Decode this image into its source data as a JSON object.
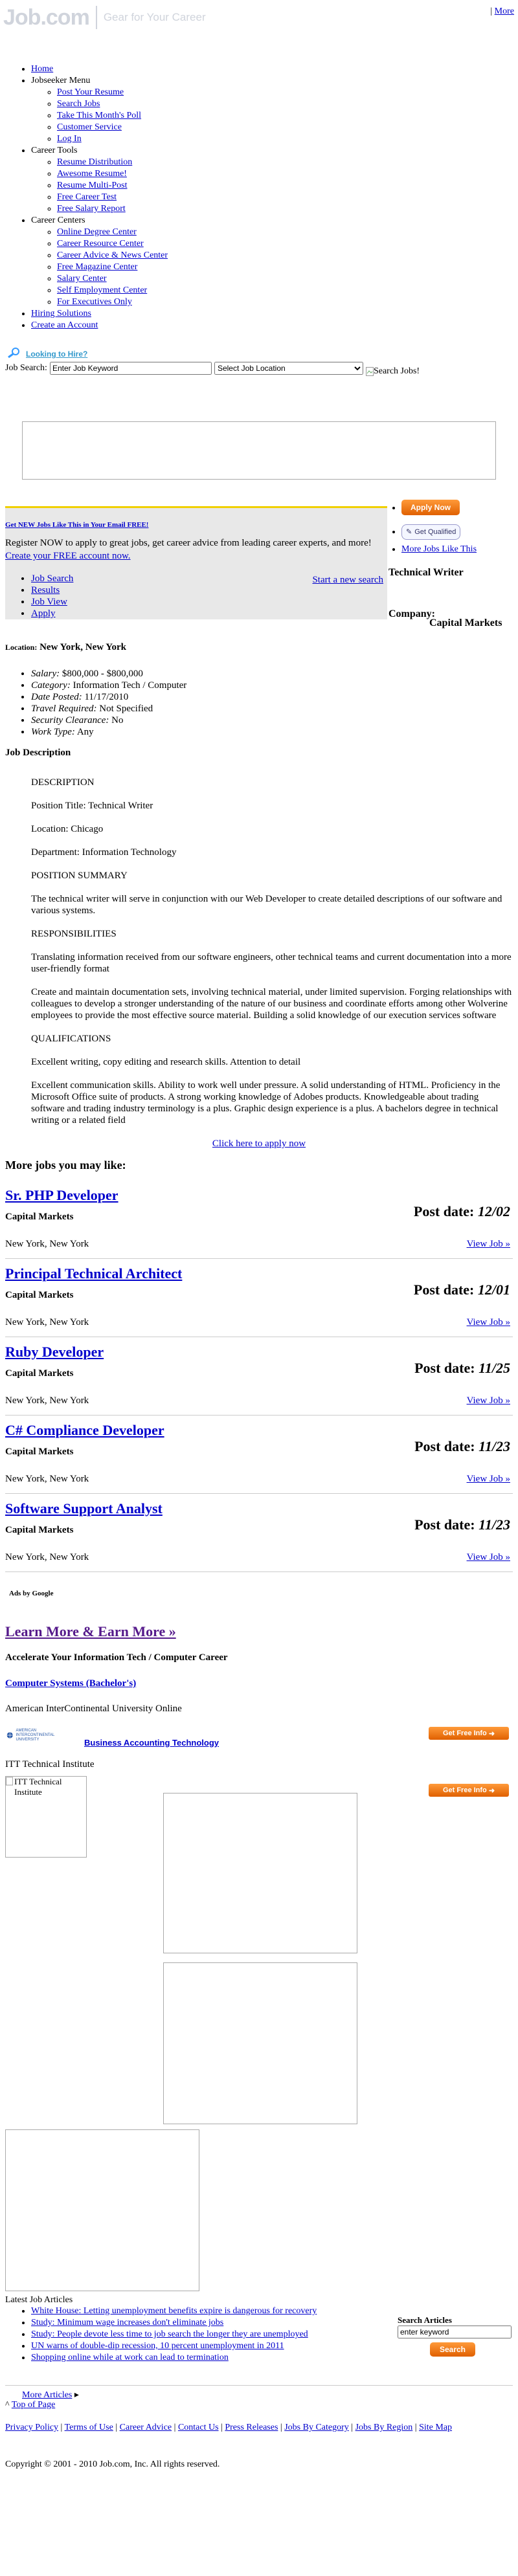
{
  "header": {
    "logo_word": "Job.com",
    "logo_tagline": "Gear for Your Career",
    "more_link": "More"
  },
  "nav": {
    "home": "Home",
    "jobseeker": {
      "label": "Jobseeker Menu",
      "items": [
        "Post Your Resume",
        "Search Jobs",
        "Take This Month's Poll",
        "Customer Service",
        "Log In"
      ]
    },
    "career_tools": {
      "label": "Career Tools",
      "items": [
        "Resume Distribution",
        "Awesome Resume!",
        "Resume Multi-Post",
        "Free Career Test",
        "Free Salary Report"
      ]
    },
    "career_centers": {
      "label": "Career Centers",
      "items": [
        "Online Degree Center",
        "Career Resource Center",
        "Career Advice & News Center",
        "Free Magazine Center",
        "Salary Center",
        "Self Employment Center",
        "For Executives Only"
      ]
    },
    "hiring": "Hiring Solutions",
    "create": "Create an Account"
  },
  "hire_link": "Looking to Hire?",
  "search": {
    "label": "Job Search:",
    "keyword_value": "Enter Job Keyword",
    "location_value": "Select Job Location",
    "button_alt": "Search Jobs!"
  },
  "jobbox": {
    "email_alert": "Get NEW Jobs Like This in Your Email FREE!",
    "register_text": "Register NOW to apply to great jobs, get career advice from leading career experts, and more!",
    "register_link": "Create your FREE account now.",
    "steps": [
      "Job Search",
      "Results",
      "Job View",
      "Apply"
    ],
    "new_search": "Start a new search"
  },
  "sidebar": {
    "apply_now": "Apply Now",
    "get_qualified": "Get Qualified",
    "more_jobs_like": "More Jobs Like This"
  },
  "job": {
    "title": "Technical Writer",
    "company_label": "Company:",
    "company": "Capital Markets",
    "location_label": "Location:",
    "location": "New York, New York",
    "details": [
      {
        "label": "Salary:",
        "value": "$800,000  -  $800,000"
      },
      {
        "label": "Category:",
        "value": "Information Tech / Computer"
      },
      {
        "label": "Date Posted:",
        "value": "11/17/2010"
      },
      {
        "label": "Travel Required:",
        "value": "Not Specified"
      },
      {
        "label": "Security Clearance:",
        "value": "No"
      },
      {
        "label": "Work Type:",
        "value": "Any"
      }
    ],
    "desc_heading": "Job Description",
    "paragraphs": [
      "DESCRIPTION",
      "Position Title: Technical Writer",
      "Location: Chicago",
      "Department: Information Technology",
      "POSITION SUMMARY",
      "The technical writer will serve in conjunction with our Web Developer to create detailed descriptions of our software and various systems.",
      "RESPONSIBILITIES",
      "Translating information received from our software engineers, other technical teams and current documentation into a more user-friendly format",
      "Create and maintain documentation sets, involving technical material, under limited supervision. Forging relationships with colleagues to develop a stronger understanding of the nature of our business and coordinate efforts among other Wolverine employees to provide the most effective source material. Building a solid knowledge of our execution services software",
      "QUALIFICATIONS",
      "Excellent writing, copy editing and research skills. Attention to detail",
      "Excellent communication skills. Ability to work well under pressure. A solid understanding of HTML. Proficiency in the Microsoft Office suite of products. A strong working knowledge of Adobes products. Knowledgeable about trading software and trading industry terminology is a plus. Graphic design experience is a plus. A bachelors degree in technical writing or a related field"
    ],
    "apply_link": "Click here to apply now"
  },
  "more_jobs": {
    "heading": "More jobs you may like:",
    "post_label": "Post date:",
    "view_label": "View Job »",
    "items": [
      {
        "title": "Sr. PHP Developer",
        "company": "Capital Markets",
        "location": "New York, New York",
        "date": "12/02"
      },
      {
        "title": "Principal Technical Architect",
        "company": "Capital Markets",
        "location": "New York, New York",
        "date": "12/01"
      },
      {
        "title": "Ruby Developer",
        "company": "Capital Markets",
        "location": "New York, New York",
        "date": "11/25"
      },
      {
        "title": "C# Compliance Developer",
        "company": "Capital Markets",
        "location": "New York, New York",
        "date": "11/23"
      },
      {
        "title": "Software Support Analyst",
        "company": "Capital Markets",
        "location": "New York, New York",
        "date": "11/23"
      }
    ]
  },
  "ads": {
    "ads_by": "Ads by Google",
    "learn_more": "Learn More & Earn More »",
    "accelerate": "Accelerate Your Information Tech / Computer Career",
    "program1": "Computer Systems (Bachelor's)",
    "school1": "American InterContinental University Online",
    "aiu_logo": "AMERICAN INTERCONTINENTAL UNIVERSITY",
    "program2": "Business Accounting Technology",
    "school2": "ITT Technical Institute",
    "itt_alt": "ITT Technical Institute",
    "get_free_info": "Get Free Info"
  },
  "articles": {
    "heading": "Latest Job Articles",
    "items": [
      "White House: Letting unemployment benefits expire is dangerous for recovery",
      "Study: Minimum wage increases don't eliminate jobs",
      "Study: People devote less time to job search the longer they are unemployed",
      "UN warns of double-dip recession, 10 percent unemployment in 2011",
      "Shopping online while at work can lead to termination"
    ],
    "search_label": "Search Articles",
    "search_value": "enter keyword",
    "search_button": "Search",
    "more_articles": "More Articles",
    "top_of_page": "Top of Page"
  },
  "footer": {
    "links": [
      "Privacy Policy",
      "Terms of Use",
      "Career Advice",
      "Contact Us",
      "Press Releases",
      "Jobs By Category",
      "Jobs By Region",
      "Site Map"
    ],
    "copyright": "Copyright © 2001 - 2010 Job.com, Inc. All rights reserved."
  },
  "colors": {
    "link": "#0000cc",
    "visited": "#551a8b",
    "orange": "#f07a10",
    "jobbox_bg": "#e8e8e8"
  }
}
